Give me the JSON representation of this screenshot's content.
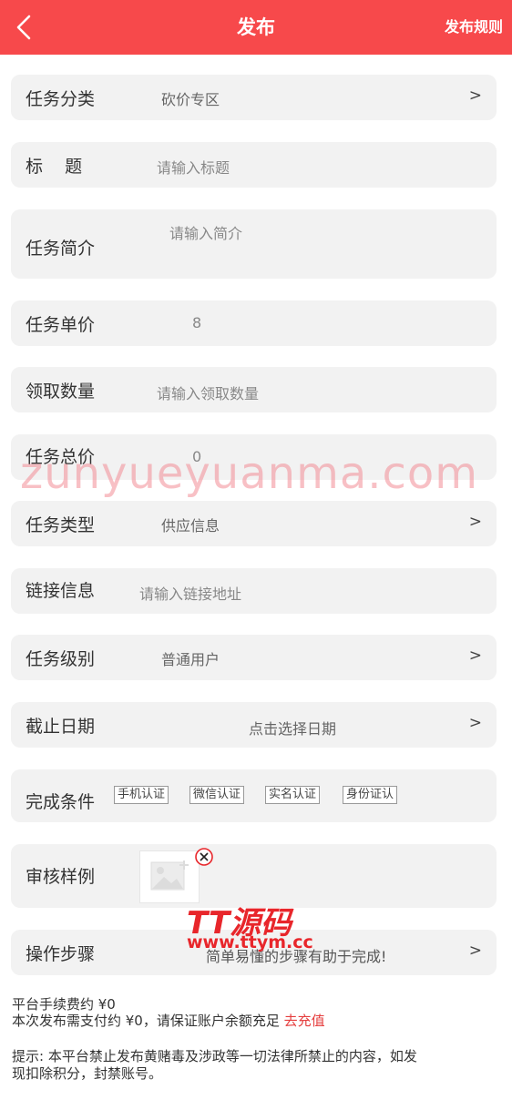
{
  "header": {
    "title": "发布",
    "rules_label": "发布规则"
  },
  "form": {
    "category": {
      "label": "任务分类",
      "value": "砍价专区",
      "chevron": ">"
    },
    "title": {
      "label": "标    题",
      "placeholder": "请输入标题"
    },
    "intro": {
      "label": "任务简介",
      "placeholder": "请输入简介"
    },
    "unit_price": {
      "label": "任务单价",
      "value": "8"
    },
    "quantity": {
      "label": "领取数量",
      "placeholder": "请输入领取数量"
    },
    "total_price": {
      "label": "任务总价",
      "value": "0"
    },
    "task_type": {
      "label": "任务类型",
      "value": "供应信息",
      "chevron": ">"
    },
    "link": {
      "label": "链接信息",
      "placeholder": "请输入链接地址"
    },
    "level": {
      "label": "任务级别",
      "value": "普通用户",
      "chevron": ">"
    },
    "deadline": {
      "label": "截止日期",
      "value": "点击选择日期",
      "chevron": ">"
    },
    "conditions": {
      "label": "完成条件",
      "tags": [
        "手机认证",
        "微信认证",
        "实名认证",
        "身份证认"
      ]
    },
    "review_sample": {
      "label": "审核样例"
    },
    "steps": {
      "label": "操作步骤",
      "placeholder": "简单易懂的步骤有助于完成!",
      "chevron": ">"
    }
  },
  "footer": {
    "fee_line": "平台手续费约 ¥0",
    "pay_line": "本次发布需支付约 ¥0，请保证账户余额充足 ",
    "recharge_label": "去充值",
    "notice_line1": "提示: 本平台禁止发布黄赌毒及涉政等一切法律所禁止的内容，如发",
    "notice_line2": "现扣除积分，封禁账号。"
  },
  "watermarks": {
    "site_text": "zunyueyuanma.com",
    "logo_text": "TT源码",
    "logo_url": "www.ttym.cc"
  },
  "colors": {
    "header_bg": "#f7494b",
    "row_bg": "#f2f2f2",
    "accent_red": "#e53d3d"
  },
  "icons": {
    "back": "chevron-left-icon",
    "close": "close-circle-icon",
    "image_placeholder": "image-placeholder-icon"
  }
}
